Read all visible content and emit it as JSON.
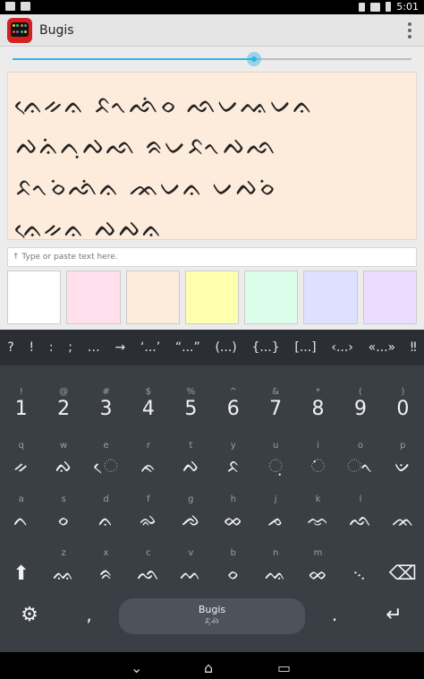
{
  "status_bar": {
    "left_icons": [
      "gmail-icon",
      "image-icon"
    ],
    "right_icons": [
      "vibrate-icon",
      "wifi-icon",
      "battery-icon"
    ],
    "time": "5:01"
  },
  "app_bar": {
    "title": "Bugis",
    "logo_colors": [
      "#f4d03f",
      "#2ecc71",
      "#e67e22",
      "#3498db",
      "#e74c3c",
      "#9b59b6",
      "#1abc9c",
      "#f1c40f"
    ]
  },
  "slider": {
    "value_fraction": 0.605,
    "accent": "#33b5e5"
  },
  "output": {
    "lines": [
      "ᨊᨙᨀᨊ ᨅᨚᨒᨗᨔ ᨒᨆᨕᨆᨊ",
      "ᨄᨊᨗᨈᨘᨄᨒ ᨑᨆᨅᨚᨄᨒ",
      "ᨅᨚᨔᨗᨒᨗᨊ ᨏᨆᨊ ᨆᨄᨔᨗ",
      "ᨊᨙᨀᨊ ᨄᨄᨊ"
    ],
    "background": "#fdebdc"
  },
  "input": {
    "placeholder": "↑ Type or paste text here."
  },
  "swatches": [
    "#ffffff",
    "#ffe0ec",
    "#fdebdc",
    "#ffffb0",
    "#dcfde9",
    "#dde0ff",
    "#ecdcff"
  ],
  "keyboard": {
    "symbols": [
      "?",
      "!",
      ":",
      ";",
      "…",
      "→",
      "‘...’",
      "“...”",
      "(...)",
      "{...}",
      "[...]",
      "‹...›",
      "«...»",
      "‼"
    ],
    "number_row": [
      {
        "hint": "!",
        "label": "1"
      },
      {
        "hint": "@",
        "label": "2"
      },
      {
        "hint": "#",
        "label": "3"
      },
      {
        "hint": "$",
        "label": "4"
      },
      {
        "hint": "%",
        "label": "5"
      },
      {
        "hint": "^",
        "label": "6"
      },
      {
        "hint": "&",
        "label": "7"
      },
      {
        "hint": "*",
        "label": "8"
      },
      {
        "hint": "(",
        "label": "9"
      },
      {
        "hint": ")",
        "label": "0"
      }
    ],
    "row1": [
      {
        "hint": "q",
        "label": "ᨀ"
      },
      {
        "hint": "w",
        "label": "ᨁ"
      },
      {
        "hint": "e",
        "label": "ᨙ"
      },
      {
        "hint": "r",
        "label": "ᨃ"
      },
      {
        "hint": "t",
        "label": "ᨄ"
      },
      {
        "hint": "y",
        "label": "ᨅ"
      },
      {
        "hint": "u",
        "label": "ᨘ"
      },
      {
        "hint": "i",
        "label": "ᨗ"
      },
      {
        "hint": "o",
        "label": "ᨚ"
      },
      {
        "hint": "p",
        "label": "ᨉ"
      }
    ],
    "row2": [
      {
        "hint": "a",
        "label": "ᨈ"
      },
      {
        "hint": "s",
        "label": "ᨔ"
      },
      {
        "hint": "d",
        "label": "ᨊ"
      },
      {
        "hint": "f",
        "label": "ᨋ"
      },
      {
        "hint": "g",
        "label": "ᨌ"
      },
      {
        "hint": "h",
        "label": "ᨖ"
      },
      {
        "hint": "j",
        "label": "ᨍ"
      },
      {
        "hint": "k",
        "label": "ᨎ"
      },
      {
        "hint": "l",
        "label": "ᨒ"
      },
      {
        "hint": "",
        "label": "ᨏ"
      }
    ],
    "row3": [
      {
        "hint": "",
        "label": "⬆"
      },
      {
        "hint": "z",
        "label": "ᨐ"
      },
      {
        "hint": "x",
        "label": "ᨑ"
      },
      {
        "hint": "c",
        "label": "ᨒ"
      },
      {
        "hint": "v",
        "label": "ᨓ"
      },
      {
        "hint": "b",
        "label": "ᨔ"
      },
      {
        "hint": "n",
        "label": "ᨕ"
      },
      {
        "hint": "m",
        "label": "ᨖ"
      },
      {
        "hint": "",
        "label": "᨞"
      },
      {
        "hint": "",
        "label": "⌫"
      }
    ],
    "bottom_left": "⚙",
    "bottom_comma": ",",
    "space_label": "Bugis",
    "space_sub": "ᨅᨘᨁᨗ",
    "bottom_period": ".",
    "enter": "↵"
  },
  "nav_bar": {
    "back": "⌄",
    "home": "⌂",
    "recents": "▭"
  }
}
